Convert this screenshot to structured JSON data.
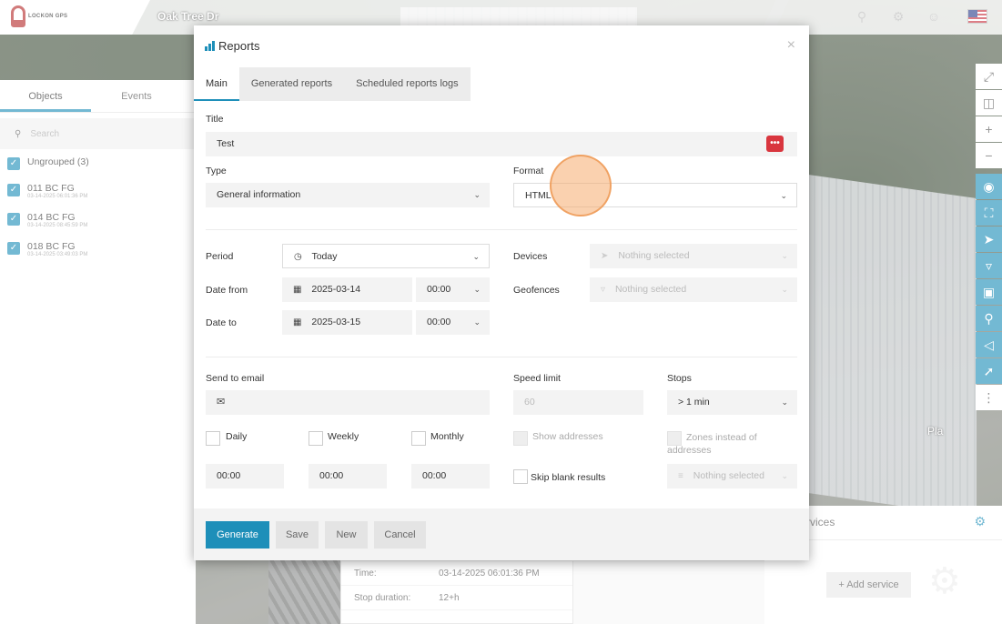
{
  "app": {
    "logo_text": "LOCKON GPS",
    "street": "Oak Tree Dr",
    "accent_color": "#1e8fb9",
    "icons": [
      "search-icon",
      "gear-icon",
      "user-icon",
      "us-flag-icon"
    ]
  },
  "sidebar": {
    "tabs": [
      "Objects",
      "Events"
    ],
    "search_placeholder": "Search",
    "group": {
      "label": "Ungrouped (3)"
    },
    "devices": [
      {
        "name": "011 BC FG",
        "time": "03-14-2025 06:01:36 PM"
      },
      {
        "name": "014 BC FG",
        "time": "03-14-2025 08:45:59 PM"
      },
      {
        "name": "018 BC FG",
        "time": "03-14-2025 03:49:03 PM"
      }
    ]
  },
  "background": {
    "services_title": "Services",
    "services_title_visible": "rvices",
    "add_service": "Add service",
    "map_label": "Pla",
    "info": [
      {
        "key": "Time:",
        "value": "03-14-2025 06:01:36 PM"
      },
      {
        "key": "Stop duration:",
        "value": "12+h"
      }
    ]
  },
  "modal": {
    "title": "Reports",
    "tabs": [
      "Main",
      "Generated reports",
      "Scheduled reports logs"
    ],
    "title_label": "Title",
    "title_value": "Test",
    "type_label": "Type",
    "type_value": "General information",
    "format_label": "Format",
    "format_value": "HTML",
    "period_label": "Period",
    "period_value": "Today",
    "date_from_label": "Date from",
    "date_from": "2025-03-14",
    "time_from": "00:00",
    "date_to_label": "Date to",
    "date_to": "2025-03-15",
    "time_to": "00:00",
    "devices_label": "Devices",
    "devices_value": "Nothing selected",
    "geofences_label": "Geofences",
    "geofences_value": "Nothing selected",
    "email_label": "Send to email",
    "speed_label": "Speed limit",
    "speed_placeholder": "60",
    "stops_label": "Stops",
    "stops_value": "> 1 min",
    "daily": "Daily",
    "weekly": "Weekly",
    "monthly": "Monthly",
    "daily_time": "00:00",
    "weekly_time": "00:00",
    "monthly_time": "00:00",
    "show_addresses": "Show addresses",
    "zones_instead": "Zones instead of addresses",
    "skip_blank": "Skip blank results",
    "zones_select": "Nothing selected",
    "buttons": {
      "generate": "Generate",
      "save": "Save",
      "new": "New",
      "cancel": "Cancel"
    }
  }
}
